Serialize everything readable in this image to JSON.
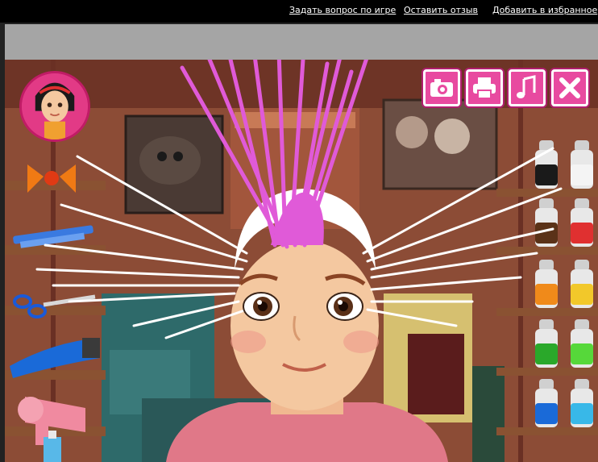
{
  "topbar": {
    "ask_link": "Задать вопрос по игре",
    "review_link": "Оставить отзыв",
    "favorite_link": "Добавить в избранное"
  },
  "toolbar": {
    "buttons": [
      "camera-icon",
      "printer-icon",
      "music-note-icon",
      "close-icon"
    ]
  },
  "colors": {
    "accent": "#e84aa0",
    "hair_pink": "#e05ad8",
    "hair_white": "#ffffff",
    "shelf": "#8a5232",
    "wall": "#8a4a34"
  },
  "tools": [
    "hair-bow",
    "comb",
    "scissors",
    "hair-trimmer",
    "hair-dryer",
    "spray-bottle"
  ],
  "dye_colors": [
    {
      "name": "black",
      "hex": "#1a1a1a"
    },
    {
      "name": "white",
      "hex": "#f4f4f4"
    },
    {
      "name": "brown",
      "hex": "#5a3218"
    },
    {
      "name": "red",
      "hex": "#e03030"
    },
    {
      "name": "orange",
      "hex": "#f08a1a"
    },
    {
      "name": "yellow",
      "hex": "#f2c82a"
    },
    {
      "name": "green",
      "hex": "#2aa82a"
    },
    {
      "name": "lime",
      "hex": "#56d83a"
    },
    {
      "name": "blue",
      "hex": "#1a6ad8"
    },
    {
      "name": "cyan",
      "hex": "#38b8e8"
    }
  ]
}
